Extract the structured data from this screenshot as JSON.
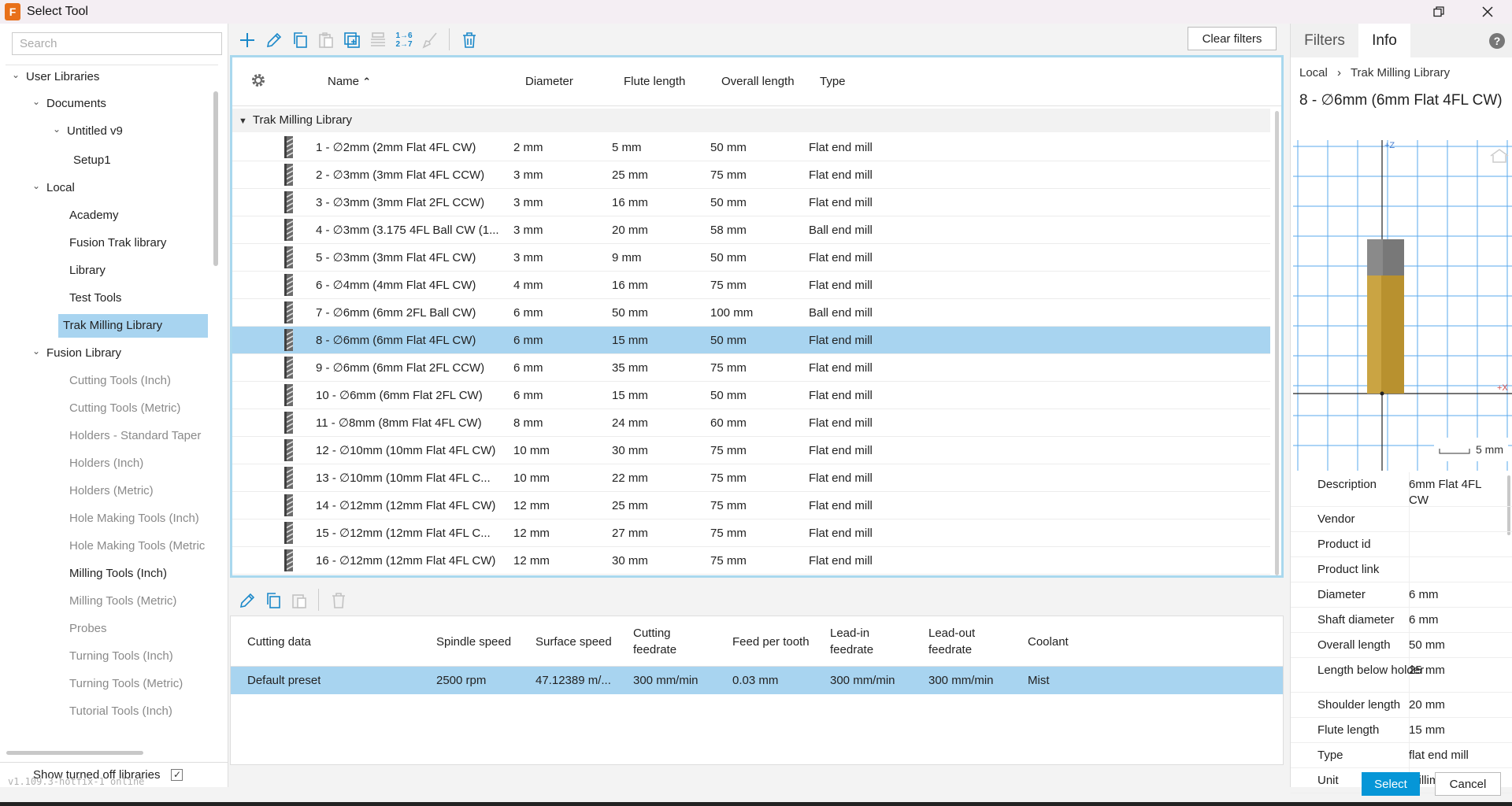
{
  "window": {
    "title": "Select Tool"
  },
  "search": {
    "placeholder": "Search"
  },
  "tree": [
    {
      "label": "User Libraries",
      "level": 0,
      "expanded": true,
      "grey": false
    },
    {
      "label": "Documents",
      "level": 1,
      "expanded": true,
      "grey": false
    },
    {
      "label": "Untitled v9",
      "level": 2,
      "expanded": true,
      "grey": false
    },
    {
      "label": "Setup1",
      "level": 3,
      "grey": false
    },
    {
      "label": "Local",
      "level": 1,
      "expanded": true,
      "grey": false
    },
    {
      "label": "Academy",
      "level": 2,
      "grey": false
    },
    {
      "label": "Fusion Trak library",
      "level": 2,
      "grey": false
    },
    {
      "label": "Library",
      "level": 2,
      "grey": false
    },
    {
      "label": "Test Tools",
      "level": 2,
      "grey": false
    },
    {
      "label": "Trak Milling Library",
      "level": 2,
      "grey": false,
      "selected": true
    },
    {
      "label": "Fusion Library",
      "level": 1,
      "expanded": true,
      "grey": false
    },
    {
      "label": "Cutting Tools (Inch)",
      "level": 2,
      "grey": true
    },
    {
      "label": "Cutting Tools (Metric)",
      "level": 2,
      "grey": true
    },
    {
      "label": "Holders - Standard Taper",
      "level": 2,
      "grey": true
    },
    {
      "label": "Holders (Inch)",
      "level": 2,
      "grey": true
    },
    {
      "label": "Holders (Metric)",
      "level": 2,
      "grey": true
    },
    {
      "label": "Hole Making Tools (Inch)",
      "level": 2,
      "grey": true
    },
    {
      "label": "Hole Making Tools (Metric",
      "level": 2,
      "grey": true
    },
    {
      "label": "Milling Tools (Inch)",
      "level": 2,
      "grey": false
    },
    {
      "label": "Milling Tools (Metric)",
      "level": 2,
      "grey": true
    },
    {
      "label": "Probes",
      "level": 2,
      "grey": true
    },
    {
      "label": "Turning Tools (Inch)",
      "level": 2,
      "grey": true
    },
    {
      "label": "Turning Tools (Metric)",
      "level": 2,
      "grey": true
    },
    {
      "label": "Tutorial Tools (Inch)",
      "level": 2,
      "grey": true
    }
  ],
  "show_turned_off": {
    "label": "Show turned off libraries",
    "checked": true,
    "check_glyph": "✓"
  },
  "toolbar": {
    "buttons": [
      "add-icon",
      "edit-icon",
      "copy-icon",
      "paste-icon",
      "duplicate-icon",
      "renumber-icon",
      "numbering-icon",
      "brush-icon",
      "delete-icon"
    ],
    "numbering_text": [
      "1→6",
      "2→7"
    ],
    "clear_filters": "Clear filters"
  },
  "tools_table": {
    "columns": {
      "name": "Name",
      "sort_glyph": "⌃",
      "diameter": "Diameter",
      "flute_length": "Flute length",
      "overall_length": "Overall length",
      "type": "Type"
    },
    "group": "Trak Milling Library",
    "rows": [
      {
        "name": "1 - ∅2mm (2mm Flat 4FL CW)",
        "diameter": "2 mm",
        "flute": "5 mm",
        "overall": "50 mm",
        "type": "Flat end mill"
      },
      {
        "name": "2 - ∅3mm (3mm Flat 4FL CCW)",
        "diameter": "3 mm",
        "flute": "25 mm",
        "overall": "75 mm",
        "type": "Flat end mill"
      },
      {
        "name": "3 - ∅3mm (3mm Flat 2FL CCW)",
        "diameter": "3 mm",
        "flute": "16 mm",
        "overall": "50 mm",
        "type": "Flat end mill"
      },
      {
        "name": "4 - ∅3mm (3.175 4FL Ball CW (1...",
        "diameter": "3 mm",
        "flute": "20 mm",
        "overall": "58 mm",
        "type": "Ball end mill"
      },
      {
        "name": "5 - ∅3mm (3mm Flat 4FL CW)",
        "diameter": "3 mm",
        "flute": "9 mm",
        "overall": "50 mm",
        "type": "Flat end mill"
      },
      {
        "name": "6 - ∅4mm (4mm Flat 4FL CW)",
        "diameter": "4 mm",
        "flute": "16 mm",
        "overall": "75 mm",
        "type": "Flat end mill"
      },
      {
        "name": "7 - ∅6mm (6mm 2FL Ball CW)",
        "diameter": "6 mm",
        "flute": "50 mm",
        "overall": "100 mm",
        "type": "Ball end mill"
      },
      {
        "name": "8 - ∅6mm (6mm Flat 4FL CW)",
        "diameter": "6 mm",
        "flute": "15 mm",
        "overall": "50 mm",
        "type": "Flat end mill",
        "selected": true
      },
      {
        "name": "9 - ∅6mm (6mm Flat 2FL CCW)",
        "diameter": "6 mm",
        "flute": "35 mm",
        "overall": "75 mm",
        "type": "Flat end mill"
      },
      {
        "name": "10 - ∅6mm (6mm Flat 2FL CW)",
        "diameter": "6 mm",
        "flute": "15 mm",
        "overall": "50 mm",
        "type": "Flat end mill"
      },
      {
        "name": "11 - ∅8mm (8mm Flat 4FL CW)",
        "diameter": "8 mm",
        "flute": "24 mm",
        "overall": "60 mm",
        "type": "Flat end mill"
      },
      {
        "name": "12 - ∅10mm (10mm Flat 4FL CW)",
        "diameter": "10 mm",
        "flute": "30 mm",
        "overall": "75 mm",
        "type": "Flat end mill"
      },
      {
        "name": "13 - ∅10mm (10mm Flat 4FL C...",
        "diameter": "10 mm",
        "flute": "22 mm",
        "overall": "75 mm",
        "type": "Flat end mill"
      },
      {
        "name": "14 - ∅12mm (12mm Flat 4FL CW)",
        "diameter": "12 mm",
        "flute": "25 mm",
        "overall": "75 mm",
        "type": "Flat end mill"
      },
      {
        "name": "15 - ∅12mm (12mm Flat 4FL C...",
        "diameter": "12 mm",
        "flute": "27 mm",
        "overall": "75 mm",
        "type": "Flat end mill"
      },
      {
        "name": "16 - ∅12mm (12mm Flat 4FL CW)",
        "diameter": "12 mm",
        "flute": "30 mm",
        "overall": "75 mm",
        "type": "Flat end mill"
      }
    ]
  },
  "cutting_data": {
    "toolbar": [
      "edit-icon",
      "copy-icon",
      "paste-icon",
      "delete-icon"
    ],
    "columns": {
      "cutting_data": "Cutting data",
      "spindle_speed": "Spindle speed",
      "surface_speed": "Surface speed",
      "cutting_feedrate": [
        "Cutting",
        "feedrate"
      ],
      "feed_per_tooth": "Feed per tooth",
      "lead_in": [
        "Lead-in",
        "feedrate"
      ],
      "lead_out": [
        "Lead-out",
        "feedrate"
      ],
      "coolant": "Coolant"
    },
    "row": {
      "name": "Default preset",
      "spindle": "2500 rpm",
      "surface": "47.12389 m/...",
      "cutting": "300 mm/min",
      "fpt": "0.03 mm",
      "lead_in": "300 mm/min",
      "lead_out": "300 mm/min",
      "coolant": "Mist"
    }
  },
  "right_panel": {
    "tabs": [
      "Filters",
      "Info"
    ],
    "active_tab": "Info",
    "help_glyph": "?",
    "breadcrumb": {
      "root": "Local",
      "sep": "›",
      "leaf": "Trak Milling Library"
    },
    "tool_title": "8 - ∅6mm (6mm Flat 4FL CW)",
    "preview": {
      "axis_z": "+Z",
      "axis_x": "+X",
      "scale": "5 mm"
    },
    "properties": [
      {
        "label": "Description",
        "value": "6mm Flat 4FL CW"
      },
      {
        "label": "Vendor",
        "value": ""
      },
      {
        "label": "Product id",
        "value": ""
      },
      {
        "label": "Product link",
        "value": ""
      },
      {
        "label": "Diameter",
        "value": "6 mm"
      },
      {
        "label": "Shaft diameter",
        "value": "6 mm"
      },
      {
        "label": "Overall length",
        "value": "50 mm"
      },
      {
        "label": "Length below holder",
        "value": "25 mm"
      },
      {
        "label": "Shoulder length",
        "value": "20 mm"
      },
      {
        "label": "Flute length",
        "value": "15 mm"
      },
      {
        "label": "Type",
        "value": "flat end mill"
      },
      {
        "label": "Unit",
        "value": "millimeters"
      }
    ]
  },
  "footer": {
    "version": "v1.109.3-hotfix-1 online",
    "select": "Select",
    "cancel": "Cancel"
  },
  "colors": {
    "accent": "#0696d7",
    "selection": "#a8d4f0",
    "panel_border": "#a9d8ee",
    "flute": "#b8912f",
    "shank": "#7a7a7a"
  }
}
